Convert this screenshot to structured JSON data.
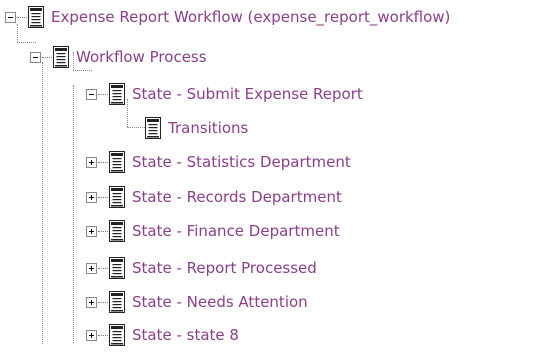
{
  "tree": {
    "root": {
      "label": "Expense Report Workflow (expense_report_workflow)"
    },
    "process": {
      "label": "Workflow Process"
    },
    "states": [
      {
        "label": "State - Submit Expense Report"
      },
      {
        "label": "State - Statistics Department"
      },
      {
        "label": "State - Records Department"
      },
      {
        "label": "State - Finance Department"
      },
      {
        "label": "State - Report Processed"
      },
      {
        "label": "State - Needs Attention"
      },
      {
        "label": "State - state 8"
      }
    ],
    "transitions": {
      "label": "Transitions"
    }
  },
  "colors": {
    "label": "#8b3f8b",
    "line": "#8a8a8a"
  },
  "icons": {
    "expanded": "minus-box-icon",
    "collapsed": "plus-box-icon",
    "node": "document-icon"
  }
}
